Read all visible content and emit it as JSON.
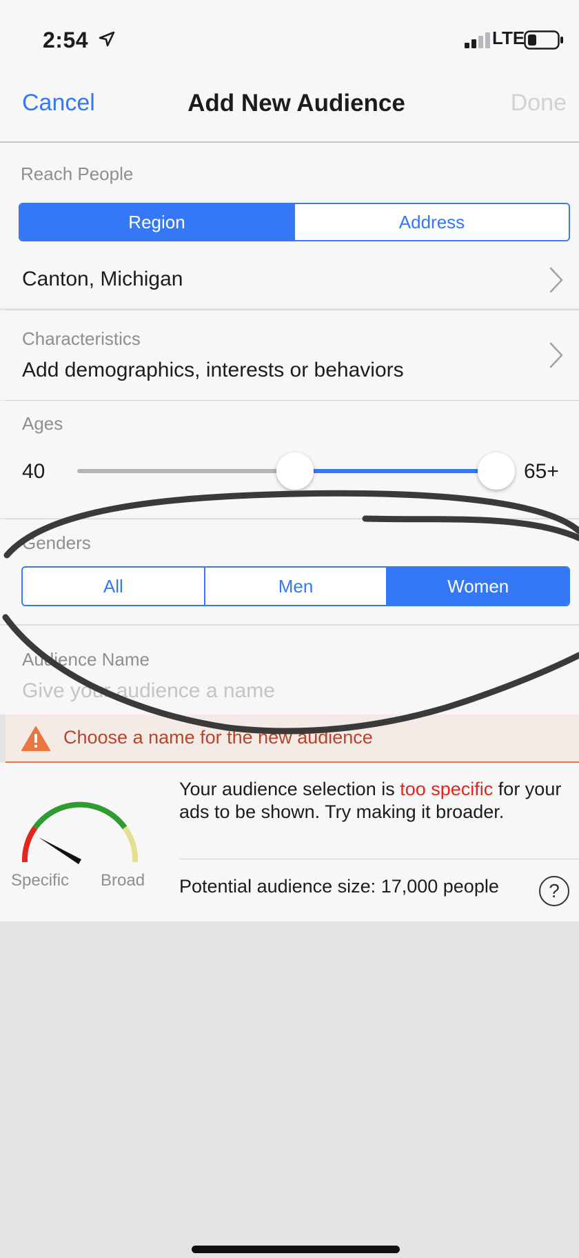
{
  "status": {
    "time": "2:54",
    "network": "LTE"
  },
  "nav": {
    "cancel": "Cancel",
    "title": "Add New Audience",
    "done": "Done"
  },
  "reach": {
    "label": "Reach People",
    "options": [
      "Region",
      "Address"
    ],
    "selected": "Region",
    "location": "Canton, Michigan"
  },
  "characteristics": {
    "label": "Characteristics",
    "value": "Add demographics, interests or behaviors"
  },
  "ages": {
    "label": "Ages",
    "min_label": "40",
    "max_label": "65+",
    "min": 40,
    "max": 65
  },
  "genders": {
    "label": "Genders",
    "options": [
      "All",
      "Men",
      "Women"
    ],
    "selected": "Women"
  },
  "audience_name": {
    "label": "Audience Name",
    "placeholder": "Give your audience a name"
  },
  "warning": {
    "text": "Choose a name for the new audience"
  },
  "feedback": {
    "message_pre": "Your audience selection is ",
    "message_highlight": "too specific",
    "message_post": " for your ads to be shown. Try making it broader.",
    "gauge_left": "Specific",
    "gauge_right": "Broad",
    "size_text": "Potential audience size: 17,000 people",
    "help_glyph": "?"
  },
  "colors": {
    "accent": "#3478f6",
    "warning": "#e9763e",
    "highlight_red": "#e3261c"
  },
  "icons": [
    "location-arrow-icon",
    "signal-bars-icon",
    "battery-icon",
    "chevron-right-icon",
    "warning-triangle-icon",
    "audience-gauge-icon",
    "help-icon"
  ]
}
